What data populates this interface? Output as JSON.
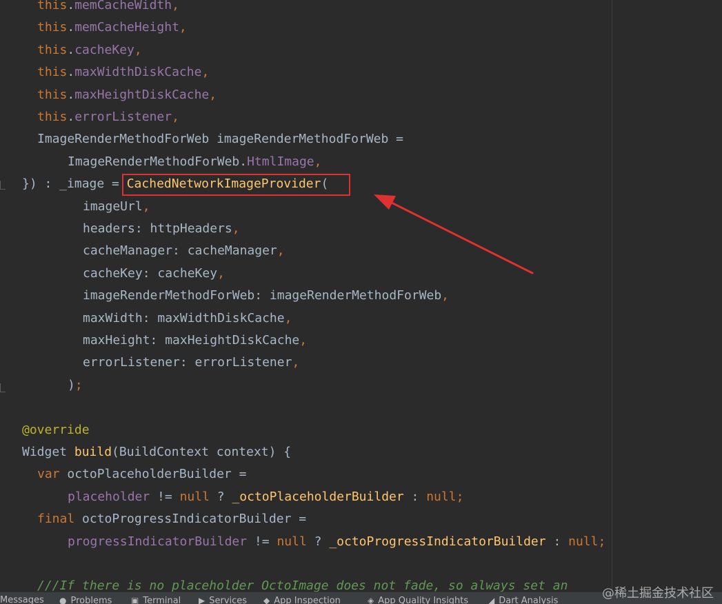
{
  "code": {
    "lines": [
      {
        "indent": 54,
        "tokens": [
          {
            "t": "this",
            "c": "kw"
          },
          {
            "t": ".",
            "c": "id"
          },
          {
            "t": "memCacheWidth",
            "c": "field"
          },
          {
            "t": ",",
            "c": "punc"
          }
        ]
      },
      {
        "indent": 54,
        "tokens": [
          {
            "t": "this",
            "c": "kw"
          },
          {
            "t": ".",
            "c": "id"
          },
          {
            "t": "memCacheHeight",
            "c": "field"
          },
          {
            "t": ",",
            "c": "punc"
          }
        ]
      },
      {
        "indent": 54,
        "tokens": [
          {
            "t": "this",
            "c": "kw"
          },
          {
            "t": ".",
            "c": "id"
          },
          {
            "t": "cacheKey",
            "c": "field"
          },
          {
            "t": ",",
            "c": "punc"
          }
        ]
      },
      {
        "indent": 54,
        "tokens": [
          {
            "t": "this",
            "c": "kw"
          },
          {
            "t": ".",
            "c": "id"
          },
          {
            "t": "maxWidthDiskCache",
            "c": "field"
          },
          {
            "t": ",",
            "c": "punc"
          }
        ]
      },
      {
        "indent": 54,
        "tokens": [
          {
            "t": "this",
            "c": "kw"
          },
          {
            "t": ".",
            "c": "id"
          },
          {
            "t": "maxHeightDiskCache",
            "c": "field"
          },
          {
            "t": ",",
            "c": "punc"
          }
        ]
      },
      {
        "indent": 54,
        "tokens": [
          {
            "t": "this",
            "c": "kw"
          },
          {
            "t": ".",
            "c": "id"
          },
          {
            "t": "errorListener",
            "c": "field"
          },
          {
            "t": ",",
            "c": "punc"
          }
        ]
      },
      {
        "indent": 54,
        "tokens": [
          {
            "t": "ImageRenderMethodForWeb imageRenderMethodForWeb =",
            "c": "id"
          }
        ]
      },
      {
        "indent": 98,
        "tokens": [
          {
            "t": "ImageRenderMethodForWeb.",
            "c": "id"
          },
          {
            "t": "HtmlImage",
            "c": "field"
          },
          {
            "t": ",",
            "c": "punc"
          }
        ]
      },
      {
        "indent": 32,
        "tokens": [
          {
            "t": "}) : _image = ",
            "c": "id"
          },
          {
            "t": "CachedNetworkImageProvider",
            "c": "fn"
          },
          {
            "t": "(",
            "c": "id"
          }
        ]
      },
      {
        "indent": 120,
        "tokens": [
          {
            "t": "imageUrl",
            "c": "id"
          },
          {
            "t": ",",
            "c": "punc"
          }
        ]
      },
      {
        "indent": 120,
        "tokens": [
          {
            "t": "headers: httpHeaders",
            "c": "id"
          },
          {
            "t": ",",
            "c": "punc"
          }
        ]
      },
      {
        "indent": 120,
        "tokens": [
          {
            "t": "cacheManager: cacheManager",
            "c": "id"
          },
          {
            "t": ",",
            "c": "punc"
          }
        ]
      },
      {
        "indent": 120,
        "tokens": [
          {
            "t": "cacheKey: cacheKey",
            "c": "id"
          },
          {
            "t": ",",
            "c": "punc"
          }
        ]
      },
      {
        "indent": 120,
        "tokens": [
          {
            "t": "imageRenderMethodForWeb: imageRenderMethodForWeb",
            "c": "id"
          },
          {
            "t": ",",
            "c": "punc"
          }
        ]
      },
      {
        "indent": 120,
        "tokens": [
          {
            "t": "maxWidth: maxWidthDiskCache",
            "c": "id"
          },
          {
            "t": ",",
            "c": "punc"
          }
        ]
      },
      {
        "indent": 120,
        "tokens": [
          {
            "t": "maxHeight: maxHeightDiskCache",
            "c": "id"
          },
          {
            "t": ",",
            "c": "punc"
          }
        ]
      },
      {
        "indent": 120,
        "tokens": [
          {
            "t": "errorListener: errorListener",
            "c": "id"
          },
          {
            "t": ",",
            "c": "punc"
          }
        ]
      },
      {
        "indent": 98,
        "tokens": [
          {
            "t": ")",
            "c": "id"
          },
          {
            "t": ";",
            "c": "punc"
          }
        ]
      },
      {
        "indent": 32,
        "tokens": []
      },
      {
        "indent": 32,
        "tokens": [
          {
            "t": "@override",
            "c": "ann"
          }
        ]
      },
      {
        "indent": 32,
        "tokens": [
          {
            "t": "Widget ",
            "c": "id"
          },
          {
            "t": "build",
            "c": "fn"
          },
          {
            "t": "(BuildContext context) {",
            "c": "id"
          }
        ]
      },
      {
        "indent": 54,
        "tokens": [
          {
            "t": "var ",
            "c": "kw"
          },
          {
            "t": "octoPlaceholderBuilder =",
            "c": "id"
          }
        ]
      },
      {
        "indent": 98,
        "tokens": [
          {
            "t": "placeholder",
            "c": "field"
          },
          {
            "t": " != ",
            "c": "id"
          },
          {
            "t": "null",
            "c": "kw"
          },
          {
            "t": " ? ",
            "c": "id"
          },
          {
            "t": "_octoPlaceholderBuilder",
            "c": "fn"
          },
          {
            "t": " : ",
            "c": "id"
          },
          {
            "t": "null;",
            "c": "kw"
          }
        ]
      },
      {
        "indent": 54,
        "tokens": [
          {
            "t": "final ",
            "c": "kw"
          },
          {
            "t": "octoProgressIndicatorBuilder =",
            "c": "id"
          }
        ]
      },
      {
        "indent": 98,
        "tokens": [
          {
            "t": "progressIndicatorBuilder",
            "c": "field"
          },
          {
            "t": " != ",
            "c": "id"
          },
          {
            "t": "null",
            "c": "kw"
          },
          {
            "t": " ? ",
            "c": "id"
          },
          {
            "t": "_octoProgressIndicatorBuilder",
            "c": "fn"
          },
          {
            "t": " : ",
            "c": "id"
          },
          {
            "t": "null;",
            "c": "kw"
          }
        ]
      },
      {
        "indent": 32,
        "tokens": []
      },
      {
        "indent": 54,
        "tokens": [
          {
            "t": "///If there is no placeholder OctoImage does not fade, so always set an",
            "c": "com"
          }
        ]
      }
    ]
  },
  "annotation": {
    "highlight_color": "#e03131",
    "highlighted_text": "CachedNetworkImageProvider("
  },
  "statusbar": {
    "items": [
      {
        "label": "Messages",
        "icon": "messages-icon",
        "glyph": ""
      },
      {
        "label": "Problems",
        "icon": "problems-icon",
        "glyph": "●"
      },
      {
        "label": "Terminal",
        "icon": "terminal-icon",
        "glyph": "▣"
      },
      {
        "label": "Services",
        "icon": "services-icon",
        "glyph": "▶"
      },
      {
        "label": "App Inspection",
        "icon": "app-inspection-icon",
        "glyph": "◆"
      },
      {
        "label": "App Quality Insights",
        "icon": "app-quality-insights-icon",
        "glyph": "◈"
      },
      {
        "label": "Dart Analysis",
        "icon": "dart-analysis-icon",
        "glyph": "◢"
      }
    ]
  },
  "watermark": "@稀土掘金技术社区",
  "colors": {
    "background": "#2b2b2b",
    "keyword": "#cc7832",
    "field": "#9876aa",
    "function": "#ffc66d",
    "text": "#a9b7c6",
    "annotation": "#bbb529",
    "comment": "#629755"
  }
}
